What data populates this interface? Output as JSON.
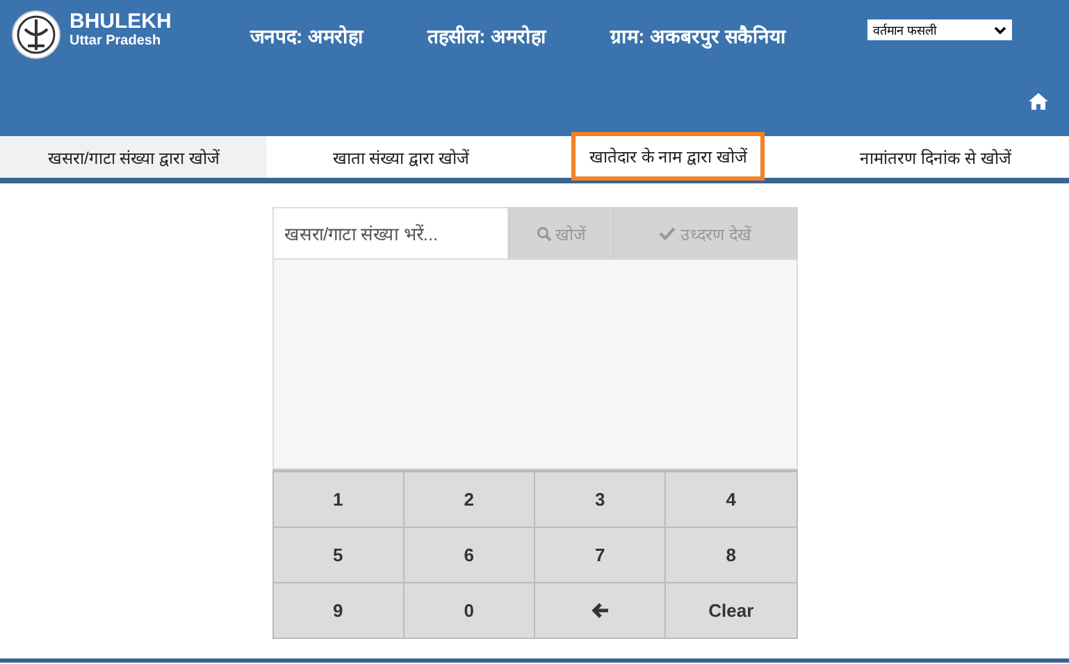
{
  "header": {
    "brand": "BHULEKH",
    "state": "Uttar Pradesh",
    "fields": [
      {
        "label": "जनपद:",
        "value": "अमरोहा"
      },
      {
        "label": "तहसील:",
        "value": "अमरोहा"
      },
      {
        "label": "ग्राम:",
        "value": "अकबरपुर सकैनिया"
      }
    ],
    "dropdown": {
      "value": "वर्तमान फसली"
    }
  },
  "tabs": [
    {
      "label": "खसरा/गाटा संख्या द्वारा खोजें",
      "selected": true,
      "highlighted": false
    },
    {
      "label": "खाता संख्या द्वारा खोजें",
      "selected": false,
      "highlighted": false
    },
    {
      "label": "खातेदार के नाम द्वारा खोजें",
      "selected": false,
      "highlighted": true
    },
    {
      "label": "नामांतरण दिनांक से खोजें",
      "selected": false,
      "highlighted": false
    }
  ],
  "search": {
    "placeholder": "खसरा/गाटा संख्या भरें...",
    "search_button": "खोजें",
    "view_button": "उध्दरण देखें",
    "disabled": true
  },
  "keypad": [
    {
      "kind": "digit",
      "label": "1"
    },
    {
      "kind": "digit",
      "label": "2"
    },
    {
      "kind": "digit",
      "label": "3"
    },
    {
      "kind": "digit",
      "label": "4"
    },
    {
      "kind": "digit",
      "label": "5"
    },
    {
      "kind": "digit",
      "label": "6"
    },
    {
      "kind": "digit",
      "label": "7"
    },
    {
      "kind": "digit",
      "label": "8"
    },
    {
      "kind": "digit",
      "label": "9"
    },
    {
      "kind": "digit",
      "label": "0"
    },
    {
      "kind": "backspace"
    },
    {
      "kind": "clear",
      "label": "Clear"
    }
  ]
}
